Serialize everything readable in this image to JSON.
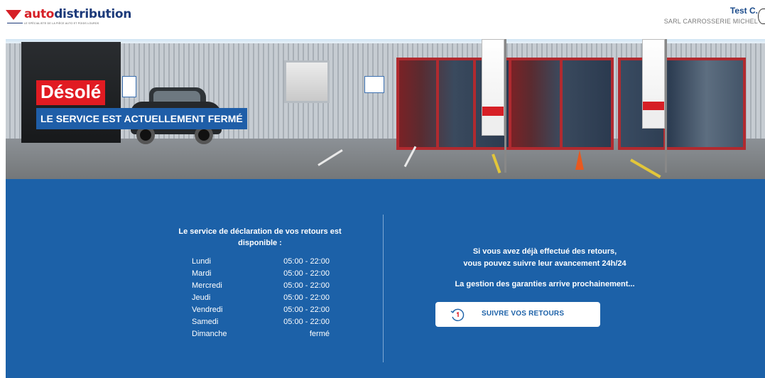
{
  "brand": {
    "name_red": "auto",
    "name_blue": "distribution",
    "tagline": "LE SPÉCIALISTE DE LA PIÈCE AUTO ET POIDS LOURDS"
  },
  "user": {
    "name": "Test C.",
    "company": "SARL CARROSSERIE MICHEL"
  },
  "hero": {
    "title": "Désolé",
    "subtitle": "LE SERVICE EST ACTUELLEMENT FERMÉ"
  },
  "availability": {
    "title": "Le service de déclaration de vos retours est disponible :",
    "schedule": [
      {
        "day": "Lundi",
        "hours": "05:00 - 22:00"
      },
      {
        "day": "Mardi",
        "hours": "05:00 - 22:00"
      },
      {
        "day": "Mercredi",
        "hours": "05:00 - 22:00"
      },
      {
        "day": "Jeudi",
        "hours": "05:00 - 22:00"
      },
      {
        "day": "Vendredi",
        "hours": "05:00 - 22:00"
      },
      {
        "day": "Samedi",
        "hours": "05:00 - 22:00"
      },
      {
        "day": "Dimanche",
        "hours": "fermé"
      }
    ]
  },
  "returns": {
    "line1": "Si vous avez déjà effectué des retours,",
    "line2": "vous pouvez suivre leur avancement 24h/24",
    "line3": "La gestion des garanties arrive prochainement...",
    "button_label": "SUIVRE VOS RETOURS"
  },
  "colors": {
    "brand_red": "#e11b22",
    "brand_blue": "#1c61a8"
  }
}
